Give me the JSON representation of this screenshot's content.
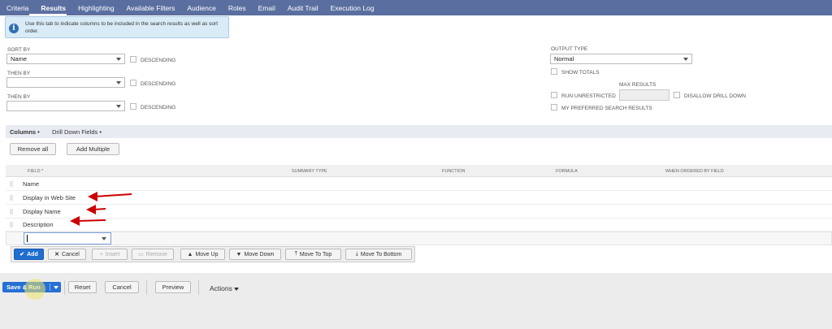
{
  "tabs": [
    {
      "label": "Criteria"
    },
    {
      "label": "Results"
    },
    {
      "label": "Highlighting"
    },
    {
      "label": "Available Filters"
    },
    {
      "label": "Audience"
    },
    {
      "label": "Roles"
    },
    {
      "label": "Email"
    },
    {
      "label": "Audit Trail"
    },
    {
      "label": "Execution Log"
    }
  ],
  "info": {
    "text": "Use this tab to indicate columns to be included in the search results as well as sort order."
  },
  "sort": {
    "sort_by_label": "SORT BY",
    "sort_by_value": "Name",
    "then_by_label_1": "THEN BY",
    "then_by_value_1": "",
    "then_by_label_2": "THEN BY",
    "then_by_value_2": "",
    "descending_label": "DESCENDING"
  },
  "output": {
    "output_type_label": "OUTPUT TYPE",
    "output_type_value": "Normal",
    "show_totals_label": "SHOW TOTALS",
    "max_results_label": "MAX RESULTS",
    "run_unrestricted_label": "RUN UNRESTRICTED",
    "disallow_drill_down_label": "DISALLOW DRILL DOWN",
    "my_preferred_label": "MY PREFERRED SEARCH RESULTS"
  },
  "subtabs": [
    {
      "label": "Columns •"
    },
    {
      "label": "Drill Down Fields •"
    }
  ],
  "buttons": {
    "remove_all": "Remove all",
    "add_multiple": "Add Multiple"
  },
  "columns_table": {
    "headers": [
      "FIELD *",
      "SUMMARY TYPE",
      "FUNCTION",
      "FORMULA",
      "WHEN ORDERED BY FIELD"
    ],
    "rows": [
      {
        "field": "Name"
      },
      {
        "field": "Display in Web Site"
      },
      {
        "field": "Display Name"
      },
      {
        "field": "Description"
      }
    ]
  },
  "row_actions": {
    "add": "Add",
    "cancel": "Cancel",
    "insert": "Insert",
    "remove": "Remove",
    "move_up": "Move Up",
    "move_down": "Move Down",
    "move_to_top": "Move To Top",
    "move_to_bottom": "Move To Bottom"
  },
  "footer": {
    "save_run": "Save & Run",
    "reset": "Reset",
    "cancel": "Cancel",
    "preview": "Preview",
    "actions": "Actions"
  },
  "colors": {
    "tabbar": "#5a6fa0",
    "primary": "#1f6ed0",
    "annotation_arrow": "#cc0000"
  }
}
